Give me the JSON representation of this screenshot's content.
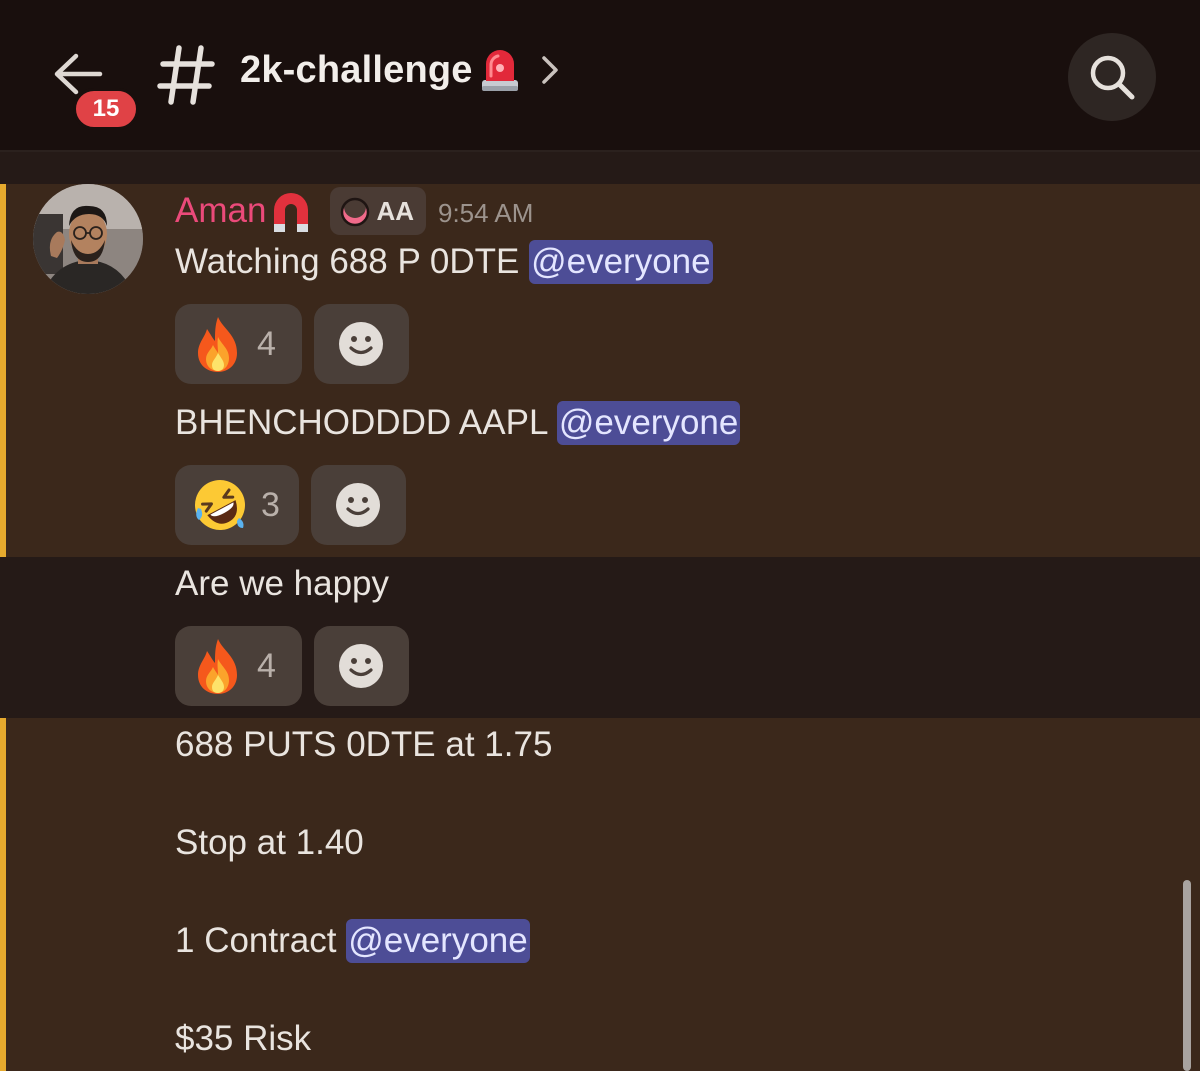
{
  "header": {
    "unread_count": "15",
    "channel_name": "2k-challenge",
    "icons": {
      "back": "arrow-left-icon",
      "channel": "hash-icon",
      "channel_emoji": "siren-icon",
      "chevron": "chevron-right-icon",
      "search": "search-icon"
    }
  },
  "message": {
    "author": "Aman",
    "author_emoji": "magnet-icon",
    "author_color": "#eb4a7a",
    "tag": {
      "icon": "crescent-moon-icon",
      "text": "AA"
    },
    "timestamp": "9:54 AM",
    "lines": [
      {
        "text": "Watching 688 P 0DTE ",
        "mention": "@everyone"
      },
      {
        "text": "BHENCHODDDD AAPL ",
        "mention": "@everyone"
      },
      {
        "text": "Are we happy"
      },
      {
        "text": "688 PUTS 0DTE at 1.75"
      },
      {
        "text": "Stop at 1.40"
      },
      {
        "text": "1 Contract ",
        "mention": "@everyone"
      },
      {
        "text": "$35 Risk"
      }
    ],
    "reactions": [
      {
        "emoji": "fire-emoji",
        "count": "4"
      },
      {
        "emoji": "rolling-on-floor-laughing-emoji",
        "count": "3"
      },
      {
        "emoji": "fire-emoji",
        "count": "4"
      }
    ]
  },
  "colors": {
    "header_bg": "#190f0d",
    "highlight_bg": "#3b281b",
    "highlight_bar": "#e6aa2e",
    "mention_bg": "#4d4d96",
    "badge": "#e04246"
  }
}
